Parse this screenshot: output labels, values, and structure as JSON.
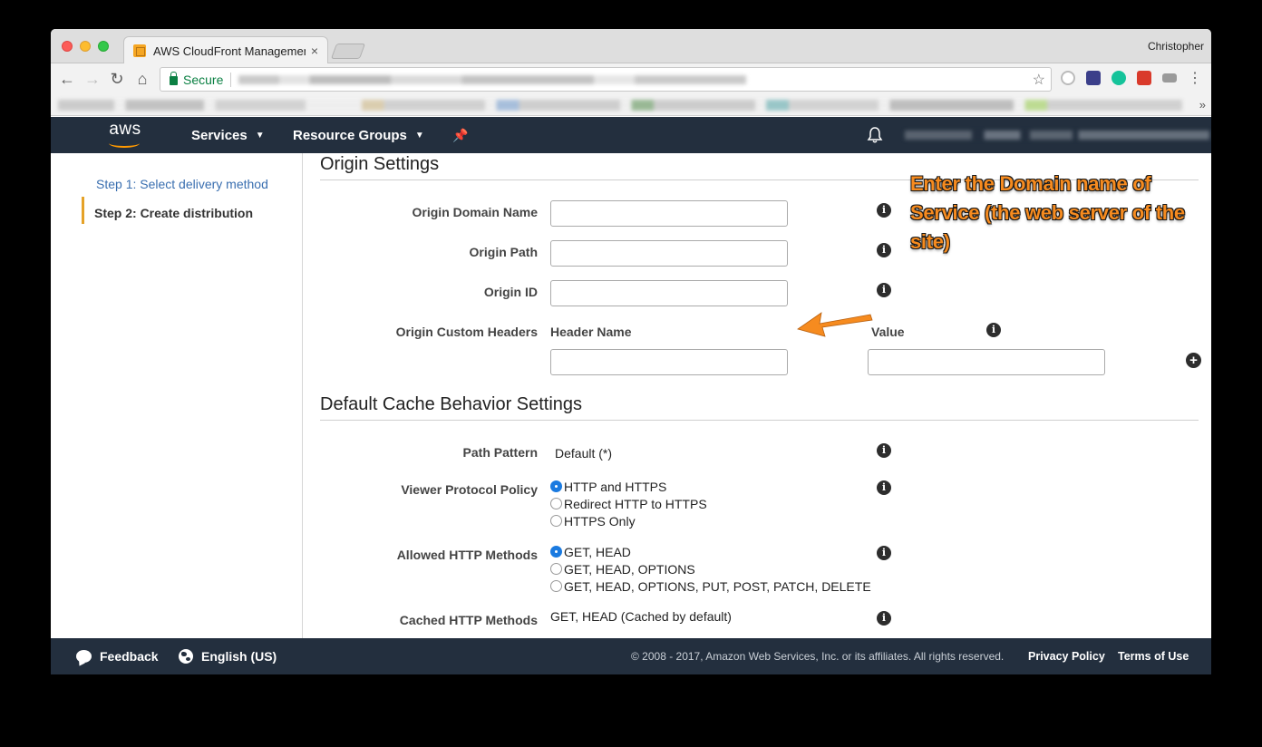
{
  "browser": {
    "tab_title": "AWS CloudFront Management",
    "tab_close": "×",
    "profile_name": "Christopher",
    "secure_label": "Secure",
    "bookmarks_more": "»"
  },
  "awsnav": {
    "logo_text": "aws",
    "services_label": "Services",
    "resource_groups_label": "Resource Groups"
  },
  "sidebar": {
    "steps": [
      {
        "label": "Step 1: Select delivery method"
      },
      {
        "label": "Step 2: Create distribution"
      }
    ]
  },
  "origin_settings": {
    "title": "Origin Settings",
    "domain_name_label": "Origin Domain Name",
    "domain_name_value": "",
    "path_label": "Origin Path",
    "path_value": "",
    "id_label": "Origin ID",
    "id_value": "",
    "custom_headers_label": "Origin Custom Headers",
    "header_name_col": "Header Name",
    "value_col": "Value"
  },
  "cache_behavior": {
    "title": "Default Cache Behavior Settings",
    "path_pattern_label": "Path Pattern",
    "path_pattern_value": "Default (*)",
    "viewer_protocol_label": "Viewer Protocol Policy",
    "viewer_protocol_options": [
      {
        "label": "HTTP and HTTPS",
        "checked": true
      },
      {
        "label": "Redirect HTTP to HTTPS",
        "checked": false
      },
      {
        "label": "HTTPS Only",
        "checked": false
      }
    ],
    "allowed_methods_label": "Allowed HTTP Methods",
    "allowed_methods_options": [
      {
        "label": "GET, HEAD",
        "checked": true
      },
      {
        "label": "GET, HEAD, OPTIONS",
        "checked": false
      },
      {
        "label": "GET, HEAD, OPTIONS, PUT, POST, PATCH, DELETE",
        "checked": false
      }
    ],
    "cached_methods_label": "Cached HTTP Methods",
    "cached_methods_value": "GET, HEAD (Cached by default)"
  },
  "annotation": {
    "text": "Enter the Domain name of Service (the web server of the site)"
  },
  "footer": {
    "feedback_label": "Feedback",
    "language_label": "English (US)",
    "copyright": "© 2008 - 2017, Amazon Web Services, Inc. or its affiliates. All rights reserved.",
    "privacy_label": "Privacy Policy",
    "terms_label": "Terms of Use"
  },
  "icons": {
    "info_glyph": "i",
    "plus_glyph": "+"
  },
  "colors": {
    "aws_nav_bg": "#232f3e",
    "aws_orange": "#ff9900",
    "step_active_bar": "#e5a228",
    "link_blue": "#3a6fb0",
    "annotation_orange": "#f68b1f",
    "radio_checked": "#1a7ae0",
    "secure_green": "#0b8043"
  }
}
